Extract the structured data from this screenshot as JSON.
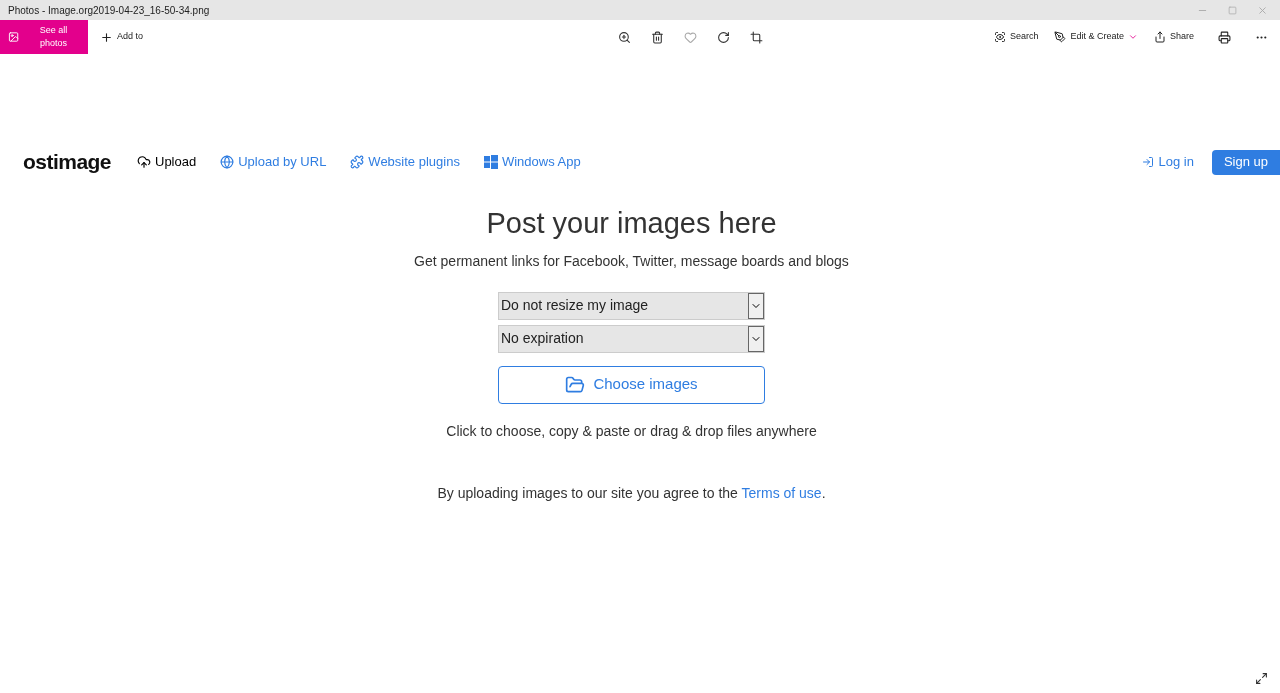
{
  "window": {
    "title": "Photos - Image.org2019-04-23_16-50-34.png"
  },
  "toolbar": {
    "see_all": "See all photos",
    "add_to": "Add to",
    "favorite": false,
    "right": [
      {
        "kind": "search",
        "label": "Search"
      },
      {
        "kind": "edit",
        "label": "Edit & Create"
      },
      {
        "kind": "share",
        "label": "Share"
      }
    ]
  },
  "site": {
    "logo": "ostimage",
    "nav": [
      {
        "kind": "upload",
        "label": "Upload",
        "selected": true
      },
      {
        "kind": "url",
        "label": "Upload by URL",
        "selected": false
      },
      {
        "kind": "plugins",
        "label": "Website plugins",
        "selected": false
      },
      {
        "kind": "windows",
        "label": "Windows App",
        "selected": false
      }
    ],
    "login": "Log in",
    "signup": "Sign up",
    "heading": "Post your images here",
    "subheading": "Get permanent links for Facebook, Twitter, message boards and blogs",
    "selects": [
      "Do not resize my image",
      "No expiration"
    ],
    "choose": "Choose images",
    "hint": "Click to choose, copy & paste or drag & drop files anywhere",
    "terms": {
      "text": "By uploading images to our site you agree to the",
      "link": "Terms of use",
      "end": "."
    }
  }
}
